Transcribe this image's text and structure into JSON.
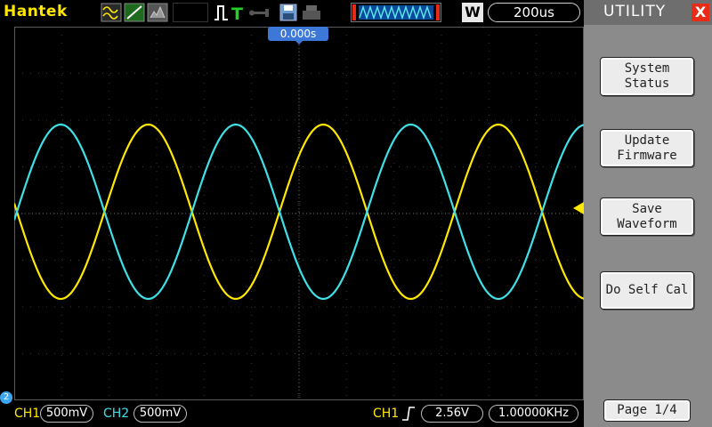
{
  "brand": "Hantek",
  "header": {
    "run_state": "W",
    "timebase": "200us",
    "trigger_position": "0.000s"
  },
  "panel": {
    "title": "UTILITY",
    "close_label": "X",
    "buttons": [
      {
        "line1": "System",
        "line2": "Status"
      },
      {
        "line1": "Update",
        "line2": "Firmware"
      },
      {
        "line1": "Save",
        "line2": "Waveform"
      },
      {
        "line1": "Do Self Cal",
        "line2": ""
      }
    ],
    "page": "Page 1/4"
  },
  "status": {
    "ch1_label": "CH1",
    "ch1_scale": "500mV",
    "ch2_label": "CH2",
    "ch2_scale": "500mV",
    "trig_source": "CH1",
    "trig_level": "2.56V",
    "frequency": "1.00000KHz",
    "ch2_marker": "2"
  },
  "colors": {
    "ch1": "#ffe800",
    "ch2": "#3fe0e8",
    "accent": "#3d78d8",
    "brand": "#ffe800"
  },
  "icons": [
    "waveform-mode-icon",
    "trigger-edge-icon",
    "usb-icon",
    "save-icon",
    "print-icon",
    "memory-depth-icon"
  ]
}
